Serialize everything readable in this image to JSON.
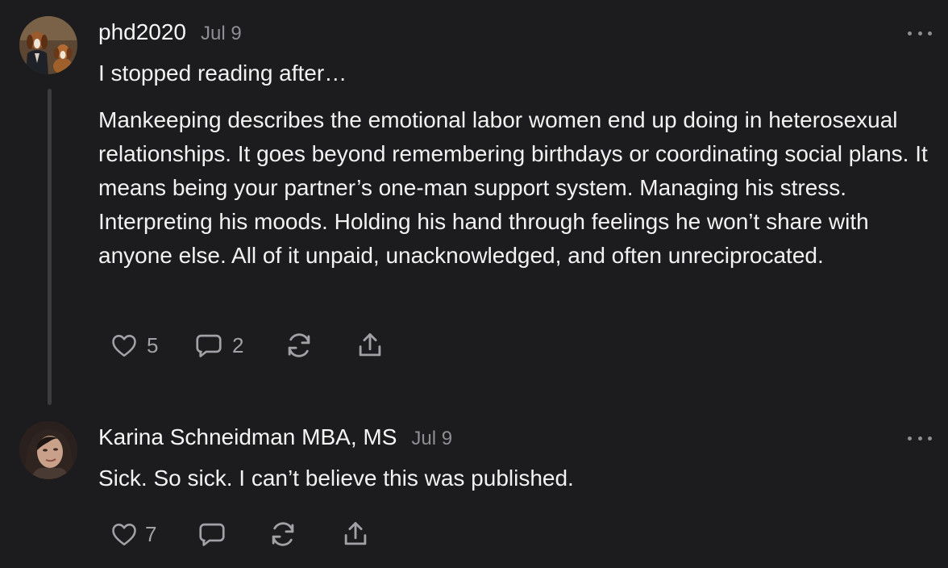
{
  "comments": [
    {
      "author": "phd2020",
      "date": "Jul 9",
      "more_icon": "ellipsis-icon",
      "paragraphs": [
        "I stopped reading after…",
        "Mankeeping describes the emotional labor women end up doing in heterosexual relationships. It goes beyond remembering birthdays or coordinating social plans. It means being your partner’s one-man support system. Managing his stress. Interpreting his moods. Holding his hand through feelings he won’t share with anyone else. All of it unpaid, unacknowledged, and often unreciprocated."
      ],
      "likes": "5",
      "replies": "2",
      "icons": [
        "heart-icon",
        "comment-icon",
        "restack-icon",
        "share-icon"
      ]
    },
    {
      "author": "Karina Schneidman MBA, MS",
      "date": "Jul 9",
      "more_icon": "ellipsis-icon",
      "paragraphs": [
        "Sick. So sick. I can’t believe this was published."
      ],
      "likes": "7",
      "replies": "",
      "icons": [
        "heart-icon",
        "comment-icon",
        "restack-icon",
        "share-icon"
      ]
    }
  ],
  "colors": {
    "background": "#1c1c1e",
    "text": "#f2f2f2",
    "muted": "#8e8e93",
    "thread_line": "#3c3c3f"
  }
}
